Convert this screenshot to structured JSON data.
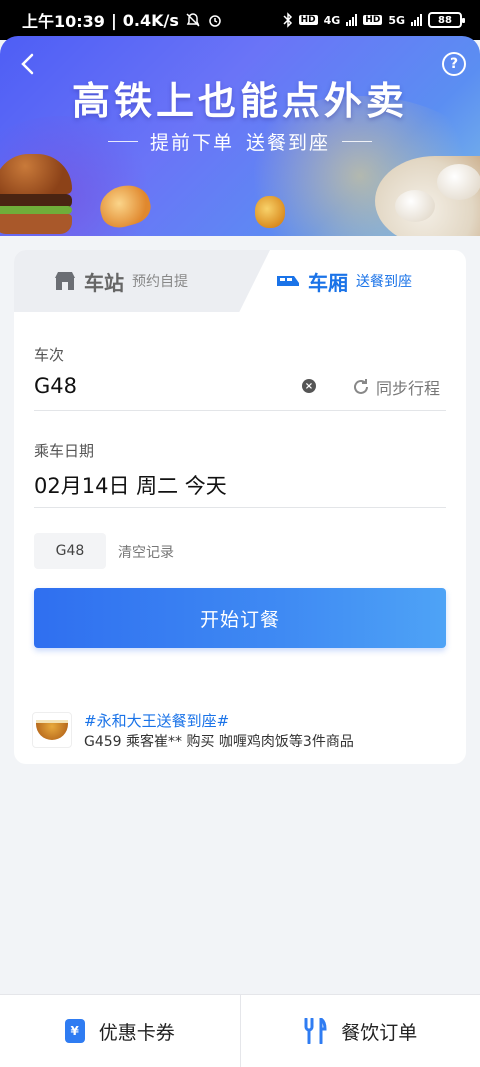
{
  "status_bar": {
    "time": "上午10:39",
    "speed": "0.4K/s",
    "network_4g": "4G",
    "network_5g": "5G",
    "hd": "HD",
    "battery": "88"
  },
  "banner": {
    "title": "高铁上也能点外卖",
    "subtitle_left": "提前下单",
    "subtitle_right": "送餐到座",
    "help_label": "?"
  },
  "tabs": [
    {
      "label": "车站",
      "sub": "预约自提"
    },
    {
      "label": "车厢",
      "sub": "送餐到座"
    }
  ],
  "form": {
    "train_label": "车次",
    "train_value": "G48",
    "sync_label": "同步行程",
    "date_label": "乘车日期",
    "date_value": "02月14日 周二 今天"
  },
  "history": {
    "chip": "G48",
    "clear_label": "清空记录"
  },
  "order_button": "开始订餐",
  "promo": {
    "tag": "#永和大王送餐到座#",
    "text": "G459 乘客崔** 购买 咖喱鸡肉饭等3件商品"
  },
  "bottom_nav": {
    "coupons": "优惠卡券",
    "orders": "餐饮订单"
  },
  "colors": {
    "accent": "#1a73e8",
    "button": "#3a82f2"
  }
}
